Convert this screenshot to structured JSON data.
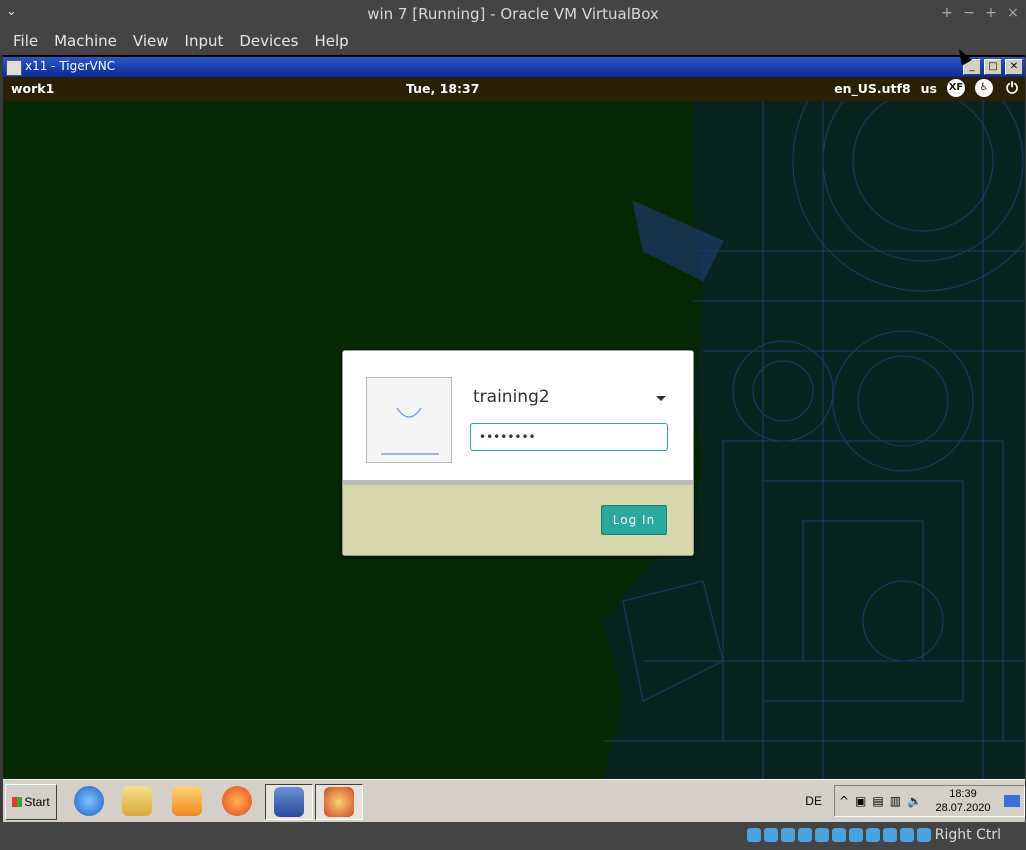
{
  "vbox": {
    "title": "win 7 [Running] - Oracle VM VirtualBox",
    "menu": [
      "File",
      "Machine",
      "View",
      "Input",
      "Devices",
      "Help"
    ],
    "host_key": "Right Ctrl"
  },
  "vnc": {
    "title": "x11 - TigerVNC"
  },
  "gnome": {
    "hostname": "work1",
    "clock": "Tue, 18:37",
    "locale": "en_US.utf8",
    "keyboard": "us"
  },
  "login": {
    "username": "training2",
    "password_mask": "••••••••",
    "login_label": "Log In"
  },
  "taskbar": {
    "start_label": "Start",
    "lang": "DE",
    "time": "18:39",
    "date": "28.07.2020"
  }
}
